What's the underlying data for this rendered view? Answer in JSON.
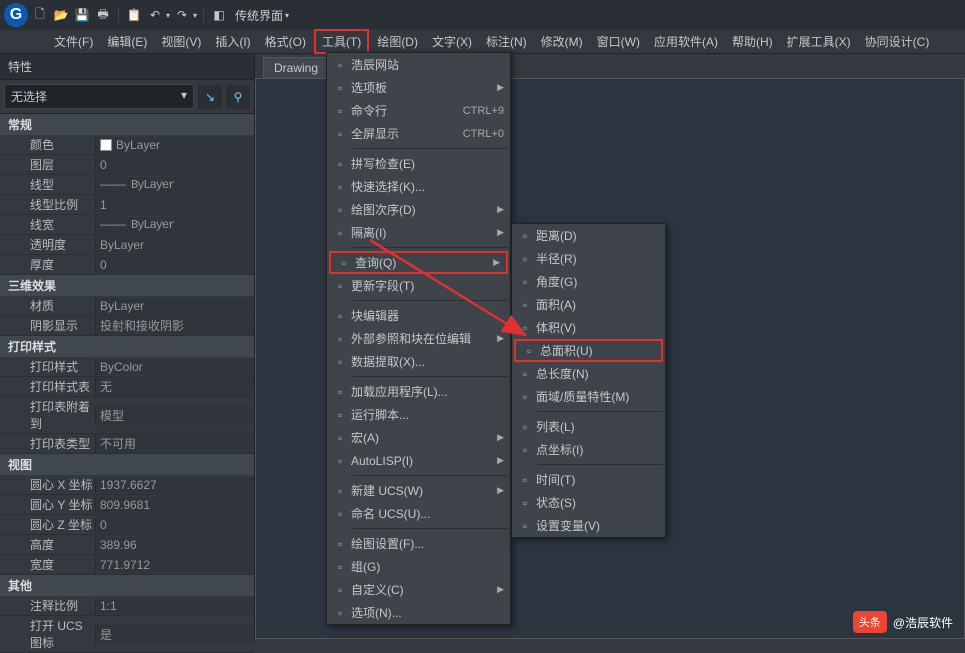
{
  "titlebar": {
    "skin_label": "传统界面"
  },
  "menubar": {
    "items": [
      "文件(F)",
      "编辑(E)",
      "视图(V)",
      "插入(I)",
      "格式(O)",
      "工具(T)",
      "绘图(D)",
      "文字(X)",
      "标注(N)",
      "修改(M)",
      "窗口(W)",
      "应用软件(A)",
      "帮助(H)",
      "扩展工具(X)",
      "协同设计(C)"
    ]
  },
  "panel": {
    "title": "特性",
    "selection": "无选择",
    "sections": {
      "general": {
        "label": "常规",
        "rows": [
          {
            "k": "颜色",
            "v": "ByLayer",
            "swatch": true
          },
          {
            "k": "图层",
            "v": "0"
          },
          {
            "k": "线型",
            "v": "———— ByLayer",
            "dash": true
          },
          {
            "k": "线型比例",
            "v": "1"
          },
          {
            "k": "线宽",
            "v": "———— ByLayer",
            "dash": true
          },
          {
            "k": "透明度",
            "v": "ByLayer"
          },
          {
            "k": "厚度",
            "v": "0"
          }
        ]
      },
      "effect": {
        "label": "三维效果",
        "rows": [
          {
            "k": "材质",
            "v": "ByLayer"
          },
          {
            "k": "阴影显示",
            "v": "投射和接收阴影"
          }
        ]
      },
      "print": {
        "label": "打印样式",
        "rows": [
          {
            "k": "打印样式",
            "v": "ByColor"
          },
          {
            "k": "打印样式表",
            "v": "无"
          },
          {
            "k": "打印表附着到",
            "v": "模型"
          },
          {
            "k": "打印表类型",
            "v": "不可用"
          }
        ]
      },
      "view": {
        "label": "视图",
        "rows": [
          {
            "k": "圆心 X 坐标",
            "v": "1937.6627"
          },
          {
            "k": "圆心 Y 坐标",
            "v": "809.9681"
          },
          {
            "k": "圆心 Z 坐标",
            "v": "0"
          },
          {
            "k": "高度",
            "v": "389.96"
          },
          {
            "k": "宽度",
            "v": "771.9712"
          }
        ]
      },
      "other": {
        "label": "其他",
        "rows": [
          {
            "k": "注释比例",
            "v": "1:1"
          },
          {
            "k": "打开 UCS 图标",
            "v": "是"
          }
        ]
      }
    }
  },
  "tab": {
    "label": "Drawing"
  },
  "menu_tools": {
    "g1": [
      {
        "t": "浩辰网站"
      },
      {
        "t": "选项板",
        "sub": true
      },
      {
        "t": "命令行",
        "a": "CTRL+9"
      },
      {
        "t": "全屏显示",
        "a": "CTRL+0"
      }
    ],
    "g2": [
      {
        "t": "拼写检查(E)"
      },
      {
        "t": "快速选择(K)..."
      },
      {
        "t": "绘图次序(D)",
        "sub": true
      },
      {
        "t": "隔离(I)",
        "sub": true
      }
    ],
    "g3": [
      {
        "t": "查询(Q)",
        "sub": true,
        "hl": true
      },
      {
        "t": "更新字段(T)"
      }
    ],
    "g4": [
      {
        "t": "块编辑器"
      },
      {
        "t": "外部参照和块在位编辑",
        "sub": true
      },
      {
        "t": "数据提取(X)..."
      }
    ],
    "g5": [
      {
        "t": "加载应用程序(L)..."
      },
      {
        "t": "运行脚本..."
      },
      {
        "t": "宏(A)",
        "sub": true
      },
      {
        "t": "AutoLISP(I)",
        "sub": true
      }
    ],
    "g6": [
      {
        "t": "新建 UCS(W)",
        "sub": true
      },
      {
        "t": "命名 UCS(U)..."
      }
    ],
    "g7": [
      {
        "t": "绘图设置(F)..."
      },
      {
        "t": "组(G)"
      },
      {
        "t": "自定义(C)",
        "sub": true
      },
      {
        "t": "选项(N)..."
      }
    ]
  },
  "submenu_query": [
    {
      "t": "距离(D)"
    },
    {
      "t": "半径(R)"
    },
    {
      "t": "角度(G)"
    },
    {
      "t": "面积(A)"
    },
    {
      "t": "体积(V)"
    },
    {
      "t": "总面积(U)",
      "hl": true
    },
    {
      "t": "总长度(N)"
    },
    {
      "t": "面域/质量特性(M)"
    },
    {
      "sep": true
    },
    {
      "t": "列表(L)"
    },
    {
      "t": "点坐标(I)"
    },
    {
      "sep": true
    },
    {
      "t": "时间(T)"
    },
    {
      "t": "状态(S)"
    },
    {
      "t": "设置变量(V)"
    }
  ],
  "watermark": {
    "badge": "头条",
    "text": "@浩辰软件"
  }
}
